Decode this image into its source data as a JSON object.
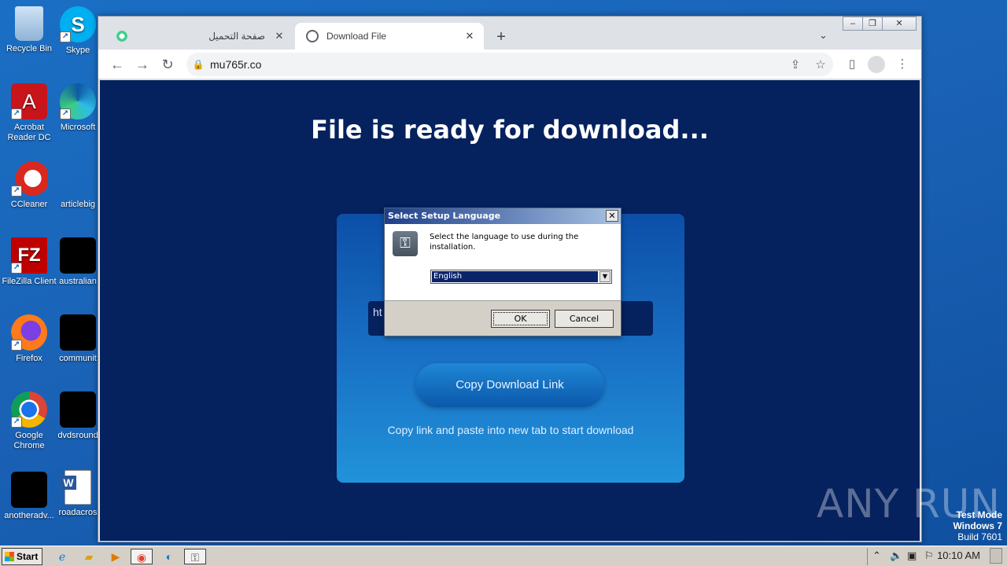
{
  "desktop": {
    "icons": [
      {
        "label": "Recycle Bin"
      },
      {
        "label": "Skype"
      },
      {
        "label": "Acrobat Reader DC"
      },
      {
        "label": "Microsoft"
      },
      {
        "label": "CCleaner"
      },
      {
        "label": "articlebig"
      },
      {
        "label": "FileZilla Client"
      },
      {
        "label": "australian"
      },
      {
        "label": "Firefox"
      },
      {
        "label": "communit"
      },
      {
        "label": "Google Chrome"
      },
      {
        "label": "dvdsround"
      },
      {
        "label": "anotheradv..."
      },
      {
        "label": "roadacros"
      }
    ]
  },
  "browser": {
    "tabs": [
      {
        "title": "صفحة التحميل"
      },
      {
        "title": "Download File"
      }
    ],
    "url": "mu765r.co"
  },
  "page": {
    "title": "File is ready for download...",
    "link_preview": "ht",
    "copy_button": "Copy Download Link",
    "hint": "Copy link and paste into new tab to start download"
  },
  "dialog": {
    "title": "Select Setup Language",
    "message": "Select the language to use during the installation.",
    "selected_language": "English",
    "ok": "OK",
    "cancel": "Cancel"
  },
  "watermark": {
    "brand": "ANY  RUN",
    "line1": "Test Mode",
    "line2": "Windows 7",
    "line3": "Build 7601"
  },
  "taskbar": {
    "start": "Start",
    "clock": "10:10 AM"
  }
}
